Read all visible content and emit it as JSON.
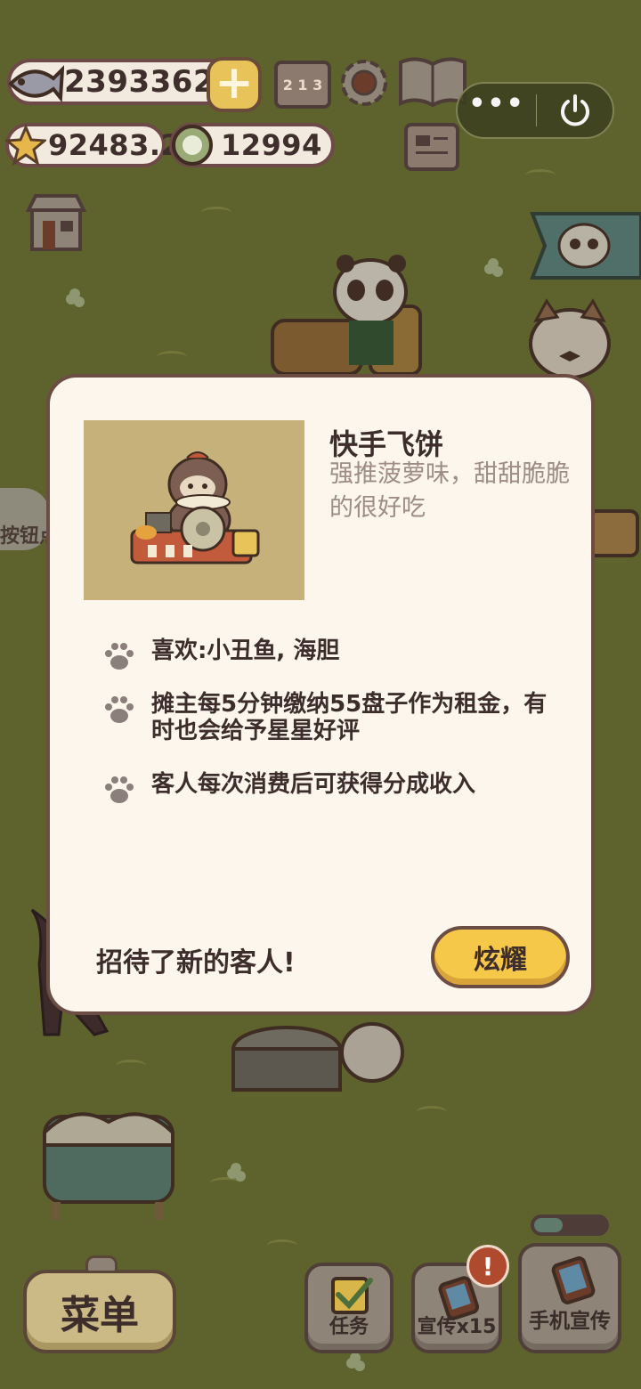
{
  "hud": {
    "fish_amount": "2393362",
    "star_amount": "92483.2",
    "plate_amount": "12994",
    "plus_symbol": "+",
    "rank_digits": "2 1 3",
    "icons": [
      "fish-icon",
      "star-icon",
      "plate-coin-icon",
      "ranking-icon",
      "settings-gear-icon",
      "recipe-book-icon",
      "news-icon",
      "shop-icon"
    ]
  },
  "capsule": {
    "more_label": "•••"
  },
  "background_text": "按钮点",
  "dialog": {
    "title": "快手飞饼",
    "description": "强推菠萝味，甜甜脆脆的很好吃",
    "features": [
      "喜欢:小丑鱼, 海胆",
      "摊主每5分钟缴纳55盘子作为租金，有时也会给予星星好评",
      "客人每次消费后可获得分成收入"
    ],
    "footer_text": "招待了新的客人!",
    "show_off_label": "炫耀"
  },
  "bottom": {
    "menu_label": "菜单",
    "task_label": "任务",
    "promo_label": "宣传x15",
    "phone_promo_label": "手机宣传",
    "alert_mark": "!",
    "promo_progress": 0.4
  },
  "colors": {
    "background": "#5e632d",
    "dialog_bg": "#fcf6ed",
    "accent_yellow": "#f6c84a",
    "border_brown": "#6b4d44"
  }
}
